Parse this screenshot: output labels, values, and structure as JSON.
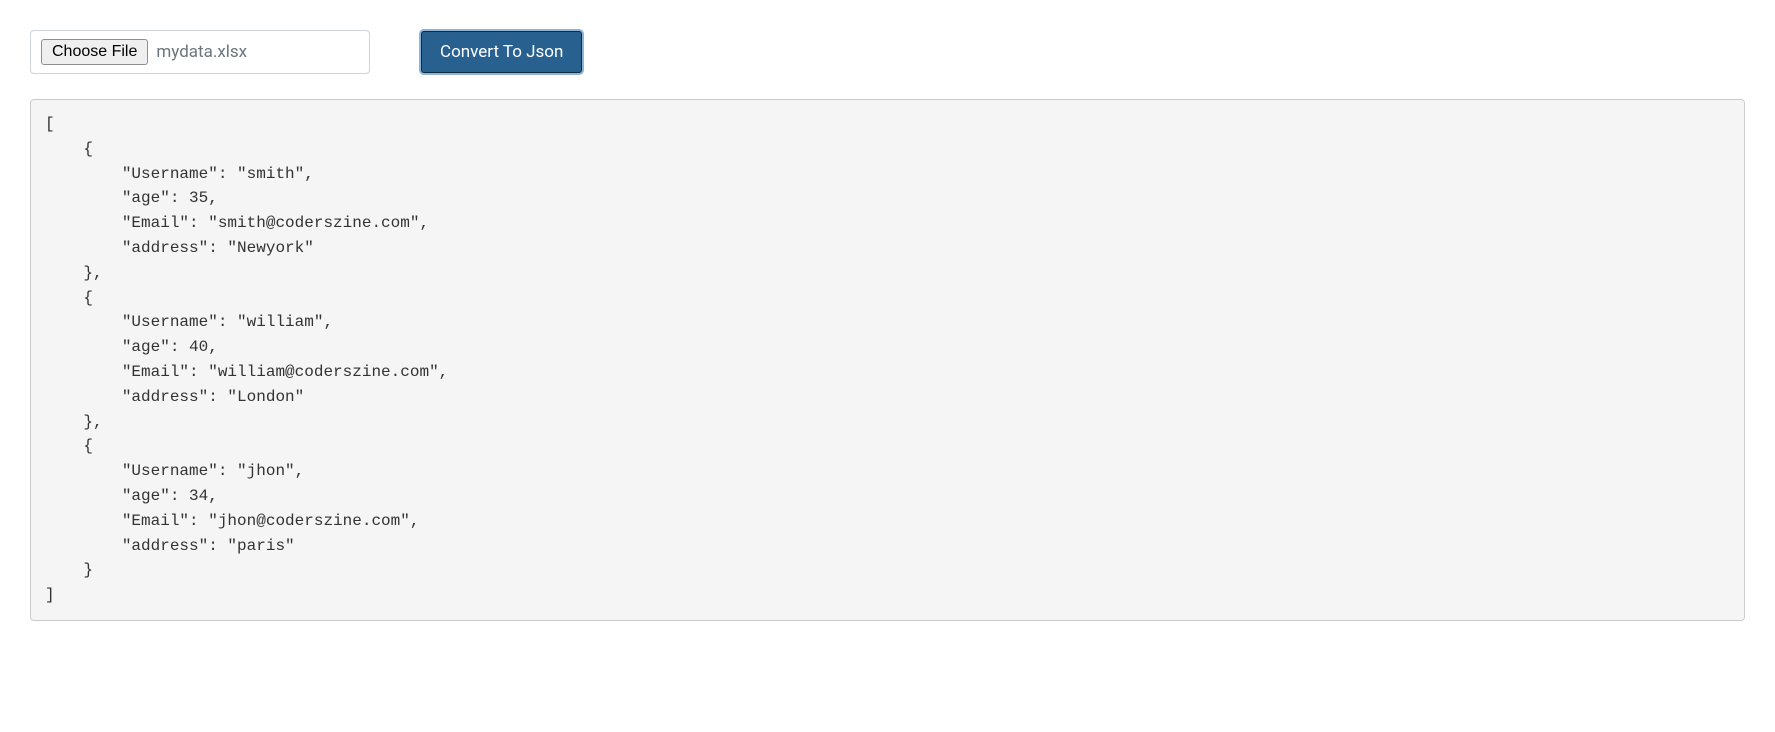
{
  "fileInput": {
    "chooseLabel": "Choose File",
    "filename": "mydata.xlsx"
  },
  "convertButton": {
    "label": "Convert To Json"
  },
  "output": {
    "records": [
      {
        "Username": "smith",
        "age": 35,
        "Email": "smith@coderszine.com",
        "address": "Newyork"
      },
      {
        "Username": "william",
        "age": 40,
        "Email": "william@coderszine.com",
        "address": "London"
      },
      {
        "Username": "jhon",
        "age": 34,
        "Email": "jhon@coderszine.com",
        "address": "paris"
      }
    ]
  }
}
